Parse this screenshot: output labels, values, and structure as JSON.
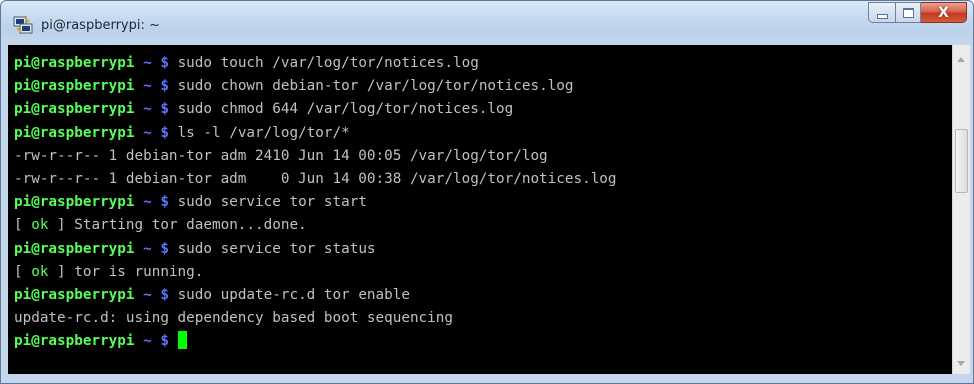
{
  "window": {
    "title": "pi@raspberrypi: ~",
    "icon": "putty-icon",
    "close_symbol": "X"
  },
  "terminal": {
    "prompt_user": "pi@raspberrypi",
    "prompt_path": " ~ $ ",
    "lines": [
      {
        "type": "command",
        "text": "sudo touch /var/log/tor/notices.log"
      },
      {
        "type": "command",
        "text": "sudo chown debian-tor /var/log/tor/notices.log"
      },
      {
        "type": "command",
        "text": "sudo chmod 644 /var/log/tor/notices.log"
      },
      {
        "type": "command",
        "text": "ls -l /var/log/tor/*"
      },
      {
        "type": "output",
        "text": "-rw-r--r-- 1 debian-tor adm 2410 Jun 14 00:05 /var/log/tor/log"
      },
      {
        "type": "output",
        "text": "-rw-r--r-- 1 debian-tor adm    0 Jun 14 00:38 /var/log/tor/notices.log"
      },
      {
        "type": "command",
        "text": "sudo service tor start"
      },
      {
        "type": "status",
        "status": "ok",
        "text": "Starting tor daemon...done."
      },
      {
        "type": "command",
        "text": "sudo service tor status"
      },
      {
        "type": "status",
        "status": "ok",
        "text": "tor is running."
      },
      {
        "type": "command",
        "text": "sudo update-rc.d tor enable"
      },
      {
        "type": "output",
        "text": "update-rc.d: using dependency based boot sequencing"
      },
      {
        "type": "prompt",
        "text": ""
      }
    ]
  },
  "colors": {
    "prompt_user": "#55ff55",
    "prompt_path": "#5c73ff",
    "text": "#c0c0c0",
    "ok": "#55ff55",
    "cursor": "#00ff00",
    "background": "#000000"
  }
}
